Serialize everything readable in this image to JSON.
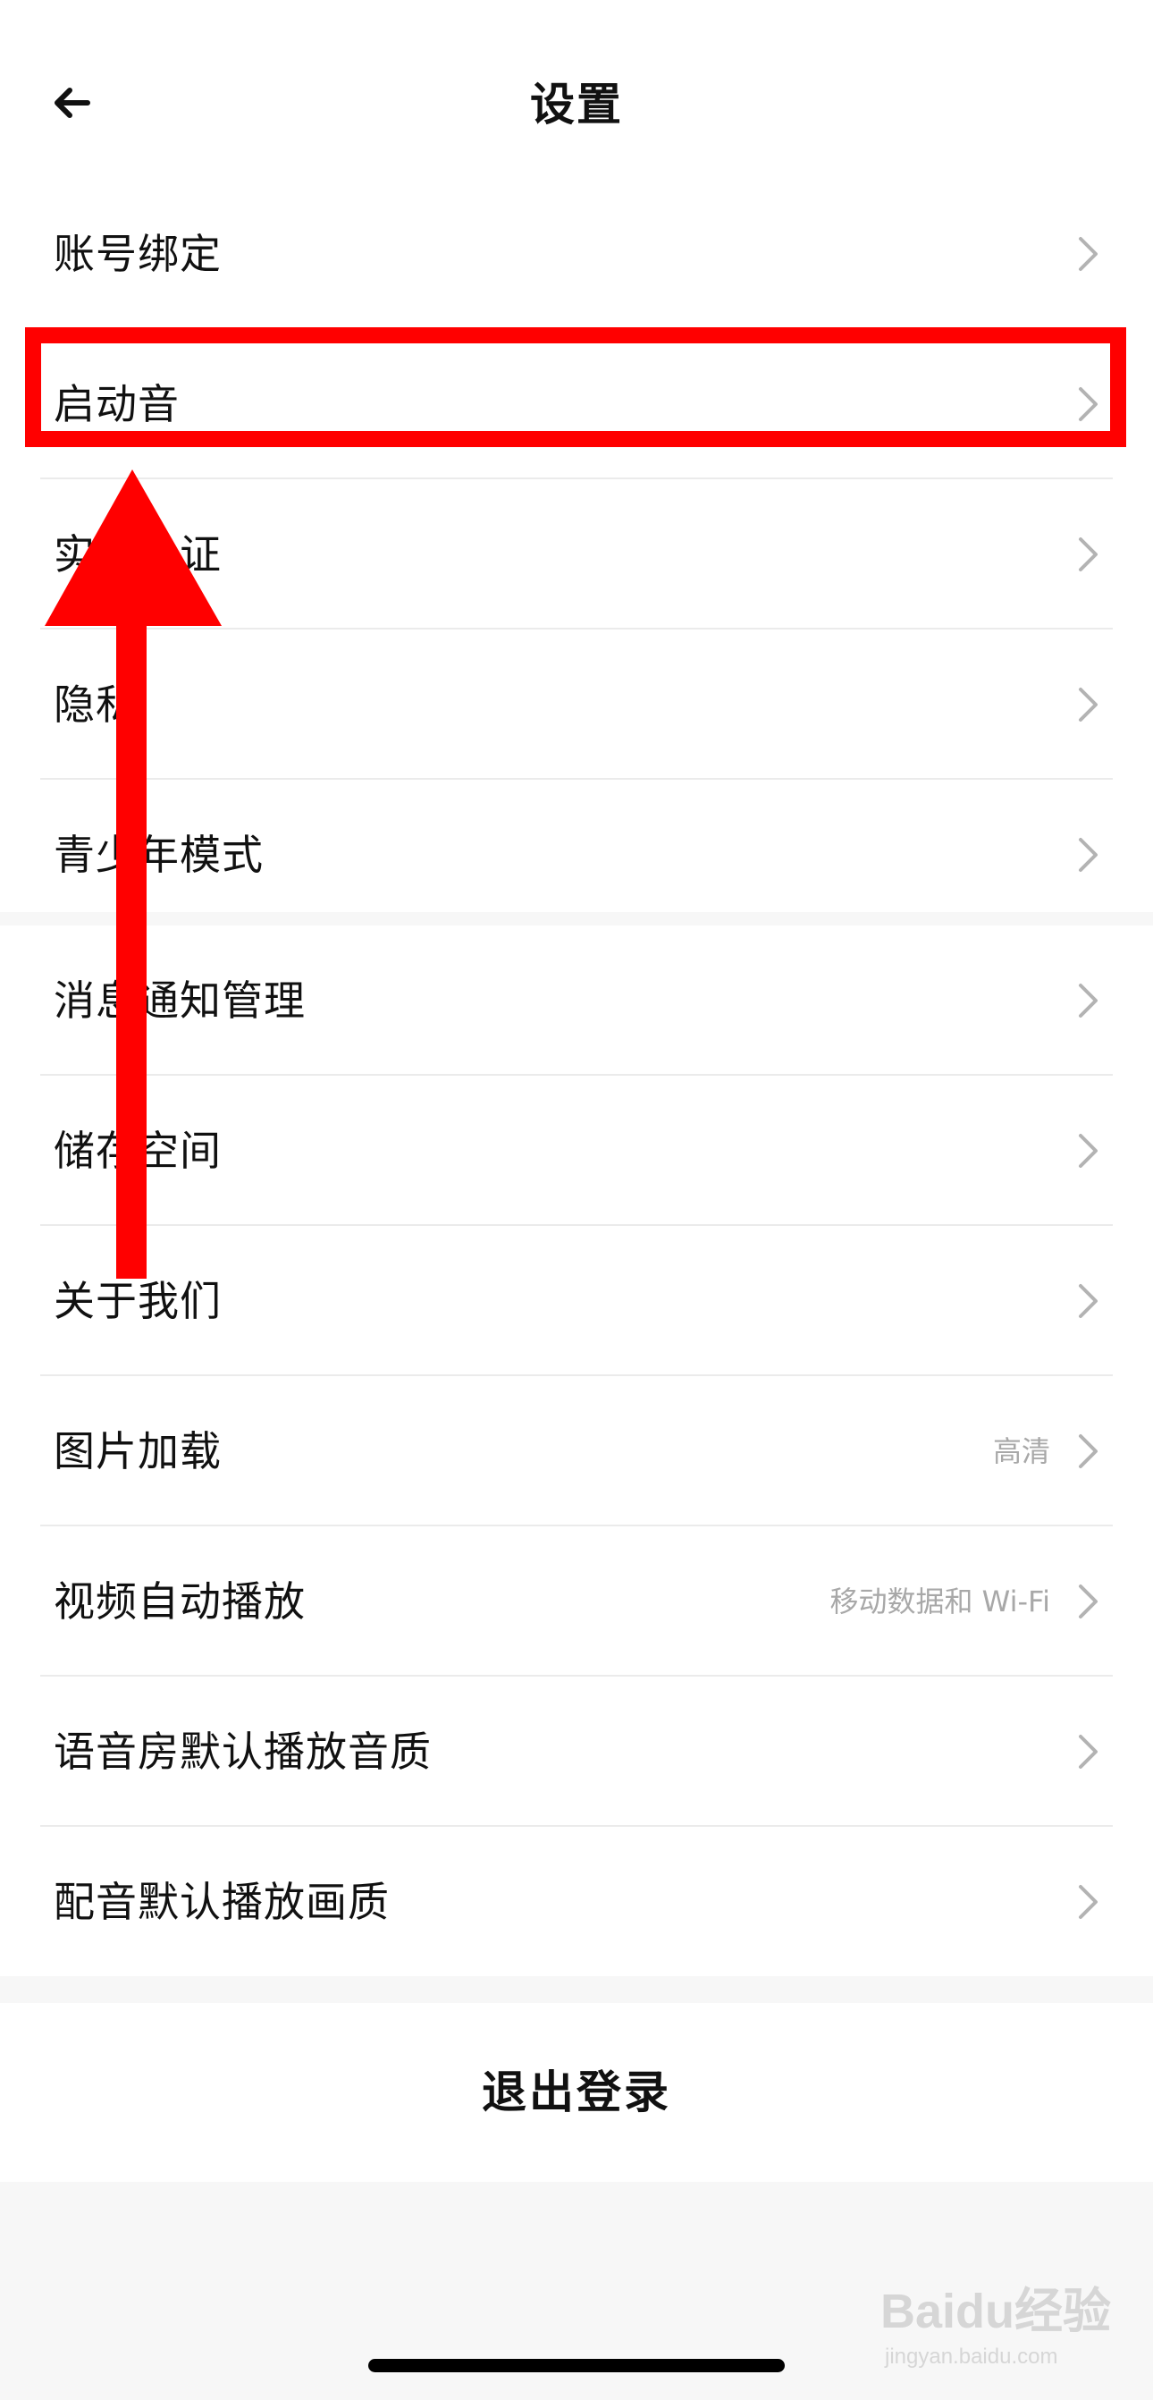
{
  "header": {
    "title": "设置",
    "back_icon": "arrow-left-icon"
  },
  "sections": [
    {
      "items": [
        {
          "label": "账号绑定"
        },
        {
          "label": "启动音"
        },
        {
          "label": "实名认证"
        },
        {
          "label": "隐私"
        },
        {
          "label": "青少年模式"
        }
      ]
    },
    {
      "items": [
        {
          "label": "消息通知管理"
        },
        {
          "label": "储存空间"
        },
        {
          "label": "关于我们"
        },
        {
          "label": "图片加载",
          "value": "高清"
        },
        {
          "label": "视频自动播放",
          "value": "移动数据和 Wi-Fi"
        },
        {
          "label": "语音房默认播放音质"
        },
        {
          "label": "配音默认播放画质"
        }
      ]
    }
  ],
  "logout": {
    "label": "退出登录"
  },
  "annotation": {
    "color": "#ff0000",
    "highlighted_item": "启动音"
  },
  "watermark": {
    "brand": "Baidu经验",
    "url": "jingyan.baidu.com"
  },
  "colors": {
    "background": "#f7f7f7",
    "surface": "#ffffff",
    "text": "#111111",
    "secondary_text": "#a8a8a8",
    "chevron": "#b3b3b3"
  }
}
